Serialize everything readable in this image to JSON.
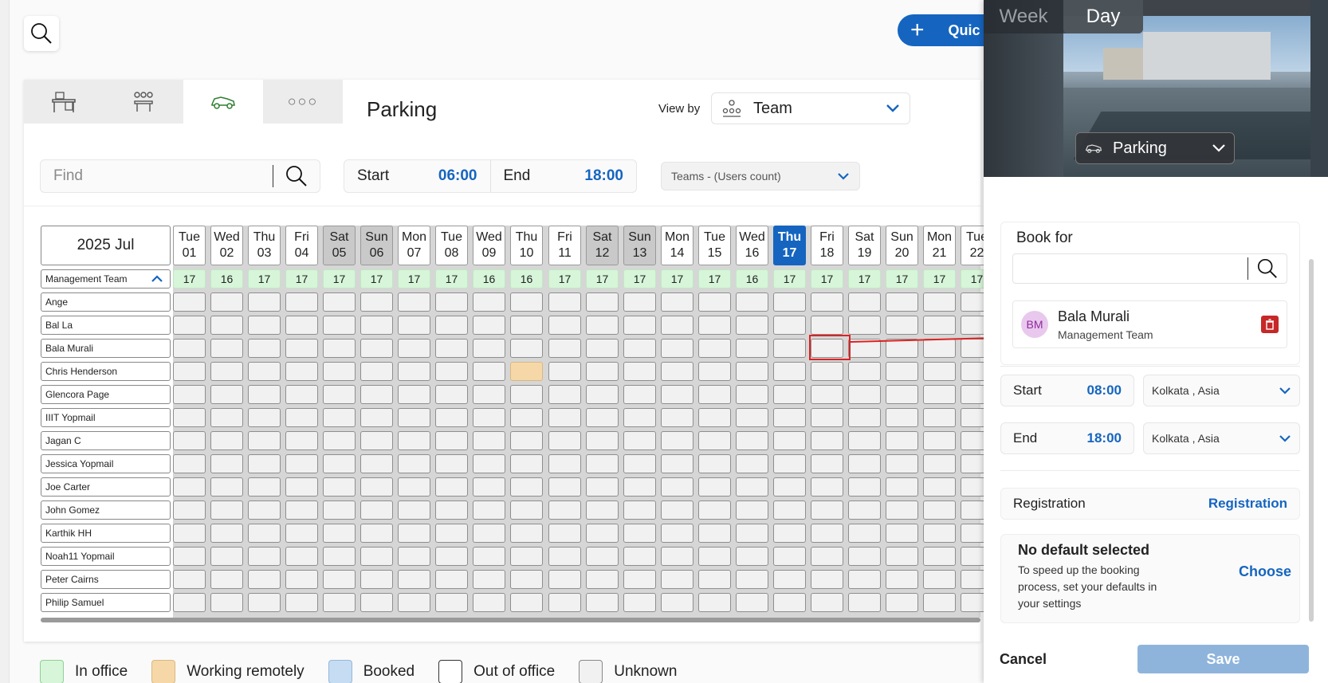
{
  "toolbar": {
    "quick_label": "Quic"
  },
  "tabs": [
    {
      "icon": "desk-icon"
    },
    {
      "icon": "meeting-room-icon"
    },
    {
      "icon": "parking-icon"
    },
    {
      "icon": "more-icon",
      "label": "○○○"
    }
  ],
  "page": {
    "title": "Parking",
    "view_by_label": "View by",
    "view_by_value": "Team"
  },
  "filters": {
    "find_placeholder": "Find",
    "start_label": "Start",
    "start_value": "06:00",
    "end_label": "End",
    "end_value": "18:00",
    "teams_label": "Teams - (Users count)"
  },
  "calendar": {
    "month": "2025 Jul",
    "team_name": "Management Team",
    "days": [
      {
        "dow": "Tue",
        "date": "01",
        "count": "17"
      },
      {
        "dow": "Wed",
        "date": "02",
        "count": "16"
      },
      {
        "dow": "Thu",
        "date": "03",
        "count": "17"
      },
      {
        "dow": "Fri",
        "date": "04",
        "count": "17"
      },
      {
        "dow": "Sat",
        "date": "05",
        "count": "17",
        "weekend": true
      },
      {
        "dow": "Sun",
        "date": "06",
        "count": "17",
        "weekend": true
      },
      {
        "dow": "Mon",
        "date": "07",
        "count": "17"
      },
      {
        "dow": "Tue",
        "date": "08",
        "count": "17"
      },
      {
        "dow": "Wed",
        "date": "09",
        "count": "16"
      },
      {
        "dow": "Thu",
        "date": "10",
        "count": "16"
      },
      {
        "dow": "Fri",
        "date": "11",
        "count": "17"
      },
      {
        "dow": "Sat",
        "date": "12",
        "count": "17",
        "weekend": true
      },
      {
        "dow": "Sun",
        "date": "13",
        "count": "17",
        "weekend": true
      },
      {
        "dow": "Mon",
        "date": "14",
        "count": "17"
      },
      {
        "dow": "Tue",
        "date": "15",
        "count": "17"
      },
      {
        "dow": "Wed",
        "date": "16",
        "count": "16"
      },
      {
        "dow": "Thu",
        "date": "17",
        "count": "17",
        "today": true
      },
      {
        "dow": "Fri",
        "date": "18",
        "count": "17"
      },
      {
        "dow": "Sat",
        "date": "19",
        "count": "17"
      },
      {
        "dow": "Sun",
        "date": "20",
        "count": "17"
      },
      {
        "dow": "Mon",
        "date": "21",
        "count": "17"
      },
      {
        "dow": "Tue",
        "date": "22",
        "count": "17"
      }
    ],
    "people": [
      "Ange",
      "Bal La",
      "Bala Murali",
      "Chris Henderson",
      "Glencora Page",
      "IIIT Yopmail",
      "Jagan C",
      "Jessica Yopmail",
      "Joe Carter",
      "John Gomez",
      "Karthik HH",
      "Noah11 Yopmail",
      "Peter Cairns",
      "Philip Samuel"
    ],
    "remote_cells": [
      {
        "person": 3,
        "day": 9
      }
    ],
    "selected_cell": {
      "person": 2,
      "day": 17
    }
  },
  "legend": [
    {
      "label": "In office",
      "color": "#d7f5d9"
    },
    {
      "label": "Working remotely",
      "color": "#f6d8a8"
    },
    {
      "label": "Booked",
      "color": "#c5dcf2"
    },
    {
      "label": "Out of office",
      "color": "#ffffff"
    },
    {
      "label": "Unknown",
      "color": "#f1f1f1"
    }
  ],
  "side": {
    "view_week": "Week",
    "view_day": "Day",
    "space_type": "Parking",
    "book_for_title": "Book for",
    "person_initials": "BM",
    "person_name": "Bala Murali",
    "person_team": "Management Team",
    "start_label": "Start",
    "start_value": "08:00",
    "start_tz": "Kolkata , Asia",
    "end_label": "End",
    "end_value": "18:00",
    "end_tz": "Kolkata , Asia",
    "registration_label": "Registration",
    "registration_link": "Registration",
    "default_title": "No default selected",
    "default_desc": "To speed up the booking process, set your defaults in your settings",
    "default_choose": "Choose",
    "cancel_label": "Cancel",
    "save_label": "Save"
  },
  "colors": {
    "accent": "#1565c0",
    "in_office": "#d7f5d9",
    "remote": "#f6d8a8",
    "delete": "#c62828"
  }
}
